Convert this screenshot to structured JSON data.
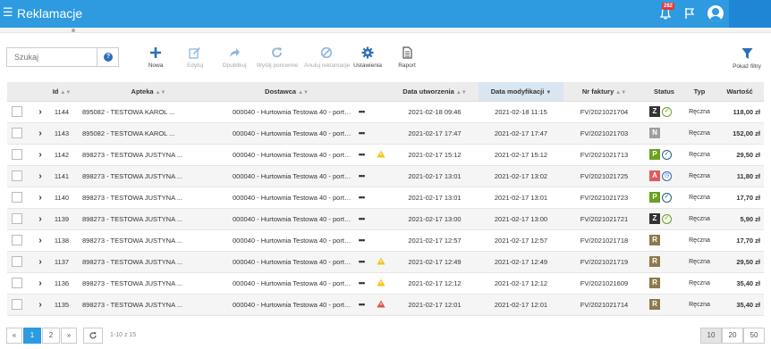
{
  "app": {
    "title": "Reklamacje",
    "menu_icon": "hamburger-icon",
    "notifications_count": "282",
    "bell_icon": "bell-icon",
    "flag_icon": "flag-icon",
    "avatar_icon": "user-avatar-icon",
    "accent": "#2e9ae0"
  },
  "search": {
    "placeholder": "Szukaj",
    "value": ""
  },
  "toolbar": {
    "new": "Nowa",
    "edit": "Edytuj",
    "publish": "Opublikuj",
    "resend": "Wyślij ponownie",
    "cancel": "Anuluj reklamacje",
    "settings": "Ustawienia",
    "report": "Raport",
    "filters": "Pokaż filtry"
  },
  "table": {
    "headers": {
      "id": "Id",
      "pharmacy": "Apteka",
      "delivery": "Dostawca",
      "created": "Data utworzenia",
      "modified": "Data modyfikacji",
      "invoice": "Nr faktury",
      "status": "Status",
      "type": "Typ",
      "value": "Wartość"
    },
    "rows": [
      {
        "id": "1144",
        "pharmacy": "895082 - TESTOWA KAROL ...",
        "delivery": "000040 - Hurtownia Testowa 40 - portal E...",
        "warn": "",
        "created": "2021-02-18 09:46",
        "modified": "2021-02-18 11:15",
        "invoice": "FV/2021021704",
        "status": "Z",
        "status_color": "#333333",
        "status_icon": "check",
        "type": "Ręczna",
        "value": "118,00 zł"
      },
      {
        "id": "1143",
        "pharmacy": "895082 - TESTOWA KAROL ...",
        "delivery": "000040 - Hurtownia Testowa 40 - portal E...",
        "warn": "",
        "created": "2021-02-17 17:47",
        "modified": "2021-02-17 17:47",
        "invoice": "FV/2021021703",
        "status": "N",
        "status_color": "#9e9e9e",
        "status_icon": "",
        "type": "Ręczna",
        "value": "152,00 zł"
      },
      {
        "id": "1142",
        "pharmacy": "898273 - TESTOWA JUSTYNA ...",
        "delivery": "000040 - Hurtownia Testowa 40 - portal E...",
        "warn": "yellow",
        "created": "2021-02-17 15:12",
        "modified": "2021-02-17 15:12",
        "invoice": "FV/2021021713",
        "status": "P",
        "status_color": "#6aa121",
        "status_icon": "check-blue",
        "type": "Ręczna",
        "value": "29,50 zł"
      },
      {
        "id": "1141",
        "pharmacy": "898273 - TESTOWA JUSTYNA ...",
        "delivery": "000040 - Hurtownia Testowa 40 - portal E...",
        "warn": "",
        "created": "2021-02-17 13:01",
        "modified": "2021-02-17 13:02",
        "invoice": "FV/2021021725",
        "status": "A",
        "status_color": "#e05a5a",
        "status_icon": "clock",
        "type": "Ręczna",
        "value": "11,80 zł"
      },
      {
        "id": "1140",
        "pharmacy": "898273 - TESTOWA JUSTYNA ...",
        "delivery": "000040 - Hurtownia Testowa 40 - portal E...",
        "warn": "",
        "created": "2021-02-17 13:01",
        "modified": "2021-02-17 13:01",
        "invoice": "FV/2021021723",
        "status": "P",
        "status_color": "#6aa121",
        "status_icon": "check-blue",
        "type": "Ręczna",
        "value": "17,70 zł"
      },
      {
        "id": "1139",
        "pharmacy": "898273 - TESTOWA JUSTYNA ...",
        "delivery": "000040 - Hurtownia Testowa 40 - portal E...",
        "warn": "",
        "created": "2021-02-17 13:00",
        "modified": "2021-02-17 13:00",
        "invoice": "FV/2021021721",
        "status": "Z",
        "status_color": "#333333",
        "status_icon": "check",
        "type": "Ręczna",
        "value": "5,90 zł"
      },
      {
        "id": "1138",
        "pharmacy": "898273 - TESTOWA JUSTYNA ...",
        "delivery": "000040 - Hurtownia Testowa 40 - portal E...",
        "warn": "",
        "created": "2021-02-17 12:57",
        "modified": "2021-02-17 12:57",
        "invoice": "FV/2021021718",
        "status": "R",
        "status_color": "#8d7a4a",
        "status_icon": "",
        "type": "Ręczna",
        "value": "17,70 zł"
      },
      {
        "id": "1137",
        "pharmacy": "898273 - TESTOWA JUSTYNA ...",
        "delivery": "000040 - Hurtownia Testowa 40 - portal E...",
        "warn": "yellow",
        "created": "2021-02-17 12:49",
        "modified": "2021-02-17 12:49",
        "invoice": "FV/2021021719",
        "status": "R",
        "status_color": "#8d7a4a",
        "status_icon": "",
        "type": "Ręczna",
        "value": "29,50 zł"
      },
      {
        "id": "1136",
        "pharmacy": "898273 - TESTOWA JUSTYNA ...",
        "delivery": "000040 - Hurtownia Testowa 40 - portal E...",
        "warn": "yellow",
        "created": "2021-02-17 12:12",
        "modified": "2021-02-17 12:12",
        "invoice": "FV/2021021609",
        "status": "R",
        "status_color": "#8d7a4a",
        "status_icon": "",
        "type": "Ręczna",
        "value": "35,40 zł"
      },
      {
        "id": "1135",
        "pharmacy": "898273 - TESTOWA JUSTYNA ...",
        "delivery": "000040 - Hurtownia Testowa 40 - portal E...",
        "warn": "red",
        "created": "2021-02-17 12:01",
        "modified": "2021-02-17 12:01",
        "invoice": "FV/2021021714",
        "status": "R",
        "status_color": "#8d7a4a",
        "status_icon": "",
        "type": "Ręczna",
        "value": "35,40 zł"
      }
    ]
  },
  "pagination": {
    "prev": "«",
    "pages": [
      "1",
      "2"
    ],
    "next": "»",
    "refresh_icon": "refresh-icon",
    "info": "1-10 z 15",
    "page_sizes": [
      "10",
      "20",
      "50"
    ],
    "active_page": "1",
    "active_size": "10"
  }
}
